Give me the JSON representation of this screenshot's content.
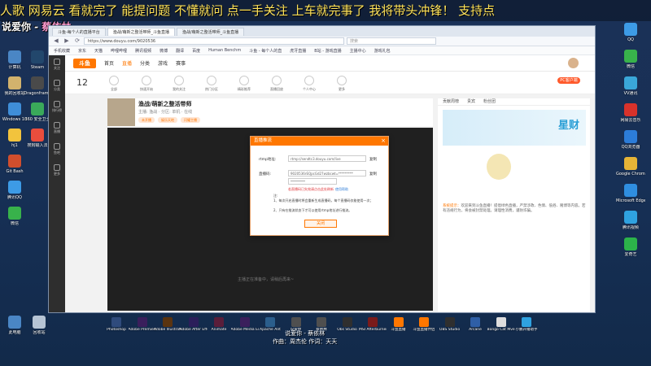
{
  "marquee": "人歌 网易云 看就完了 能提问题 不懂就问 点一手关注 上车就完事了 我将带头冲锋！ 支持点",
  "lyric_overlay": {
    "prefix": "说爱你 -",
    "name": "蔡依林"
  },
  "credits": {
    "line1": "说爱你 - 蔡依林",
    "line2": "作曲：周杰伦 作词：天天"
  },
  "desktop_left_icons": [
    {
      "label": "计算机",
      "color": "#4a86c5"
    },
    {
      "label": "我的回收站",
      "color": "#d2b26d"
    },
    {
      "label": "Windows 10",
      "color": "#3f8ed8"
    },
    {
      "label": "hj1",
      "color": "#f2c33d"
    },
    {
      "label": "Git Bash",
      "color": "#d14e2d"
    },
    {
      "label": "腾讯QQ",
      "color": "#3d9be6"
    },
    {
      "label": "微信",
      "color": "#38b24b"
    },
    {
      "label": "Steam",
      "color": "#22476c"
    },
    {
      "label": "Dragonframe",
      "color": "#4a4a4a"
    },
    {
      "label": "360 安全卫士",
      "color": "#3aa95a"
    },
    {
      "label": "搜狗输入法",
      "color": "#e94d3d"
    },
    {
      "label": "此电脑",
      "color": "#4a86c5"
    },
    {
      "label": "回收站",
      "color": "#b6c4d4"
    }
  ],
  "desktop_right_icons": [
    {
      "label": "QQ",
      "color": "#3d9be6"
    },
    {
      "label": "微信",
      "color": "#38b24b"
    },
    {
      "label": "VV通讯",
      "color": "#3aa7d9"
    },
    {
      "label": "网易云音乐",
      "color": "#d8322b"
    },
    {
      "label": "QQ浏览器",
      "color": "#2c7cd8"
    },
    {
      "label": "Google Chrome",
      "color": "#e6b437"
    },
    {
      "label": "Microsoft Edge",
      "color": "#2f8ee0"
    },
    {
      "label": "腾讯视频",
      "color": "#2fa2e0"
    },
    {
      "label": "爱奇艺",
      "color": "#2cb34a"
    }
  ],
  "taskbar_icons": [
    {
      "label": "Photoshop",
      "color": "#2f4b7c"
    },
    {
      "label": "Adobe Premiere",
      "color": "#3a1f5c"
    },
    {
      "label": "Adobe Illustrator",
      "color": "#5a3410"
    },
    {
      "label": "Adobe After Effects",
      "color": "#2b1e5a"
    },
    {
      "label": "Animate",
      "color": "#5a1e3a"
    },
    {
      "label": "Adobe Media Encoder",
      "color": "#3b1f5c"
    },
    {
      "label": "Apache Ant",
      "color": "#2b5e8c"
    },
    {
      "label": "说爱你",
      "color": "#4f4f4f"
    },
    {
      "label": "蔡依林",
      "color": "#4f4f4f"
    },
    {
      "label": "Obs Studio",
      "color": "#2f2f2f"
    },
    {
      "label": "MSI Afterburner",
      "color": "#7a1b1b"
    },
    {
      "label": "斗鱼直播",
      "color": "#ff7700"
    },
    {
      "label": "斗鱼直播伴侣",
      "color": "#ff7700"
    },
    {
      "label": "OBS Studio",
      "color": "#2f2f2f"
    },
    {
      "label": "Arcane",
      "color": "#2f5fa6"
    },
    {
      "label": "Bongo Cat Mver",
      "color": "#dddddd"
    },
    {
      "label": "小鹏开播助手",
      "color": "#2fa2e0"
    }
  ],
  "browser": {
    "tabs": [
      "斗鱼-每个人的直播平台",
      "渔战/萌新之整活带师_斗鱼直播",
      "渔战/萌新之整活带师_斗鱼直播"
    ],
    "back": "◀",
    "forward": "▶",
    "refresh": "⟳",
    "address": "https://www.douyu.com/9020536",
    "search_placeholder": "搜索",
    "bookmarks": [
      "手机收藏",
      "京东",
      "天猫",
      "哔哩哔哩",
      "腾讯视频",
      "微博",
      "翻译",
      "百度",
      "Human Benchm",
      "斗鱼 - 每个人的直",
      "虎牙直播",
      "B站 - 游戏直播",
      "主播中心",
      "游戏礼包"
    ]
  },
  "site": {
    "left_nav": [
      "关注",
      "分类",
      "排行榜",
      "直播",
      "鱼吧",
      "更多"
    ],
    "logo": "斗鱼",
    "nav": [
      "首页",
      "直播",
      "分类",
      "游戏",
      "赛事"
    ],
    "active_nav_index": 1,
    "category_count": "12",
    "categories": [
      "全部",
      "快速开始",
      "我的关注",
      "热门分区",
      "精彩推荐",
      "直播回放",
      "个人中心",
      "更多"
    ],
    "pc_button": "PC客户端"
  },
  "room": {
    "title": "渔战/萌新之整活带师",
    "sub": "主播: 渔战 · 分区: 单机 · 在线",
    "tags": [
      "未开播",
      "娱乐天地",
      "闪耀主播"
    ],
    "video_hint": "主播正在准备中，请稍后再来~"
  },
  "right_panel": {
    "tabs": [
      "贡献周榜",
      "贵宾",
      "粉丝团"
    ],
    "banner_text": "星财",
    "message_prefix": "系统提示：",
    "message": "欢迎来到斗鱼直播！提倡绿色直播，严禁涉政、色情、低俗、赌博等内容。若有违规行为，将会被封禁处理。请理性消费，谨防诈骗。"
  },
  "dialog": {
    "title": "直播推流",
    "close": "×",
    "rtmp_label": "rtmp地址:",
    "rtmp_value": "rtmp://sendtc3.douyu.com/live",
    "stream_label": "直播码:",
    "stream_value": "9020536rEQpcGd27wzbcwt=*********",
    "copy": "复制",
    "select_value": "*********",
    "warning_link": "若直播码已失效请点击此处刷新",
    "help_link": "使用帮助",
    "notes_title": "注:",
    "notes": [
      "1、每次开启直播时将会重新生成直播码，每个直播码仅能使用一次；",
      "2、只有在推流状态下才可以使用rtmp地址进行推流。"
    ],
    "button": "关闭"
  }
}
